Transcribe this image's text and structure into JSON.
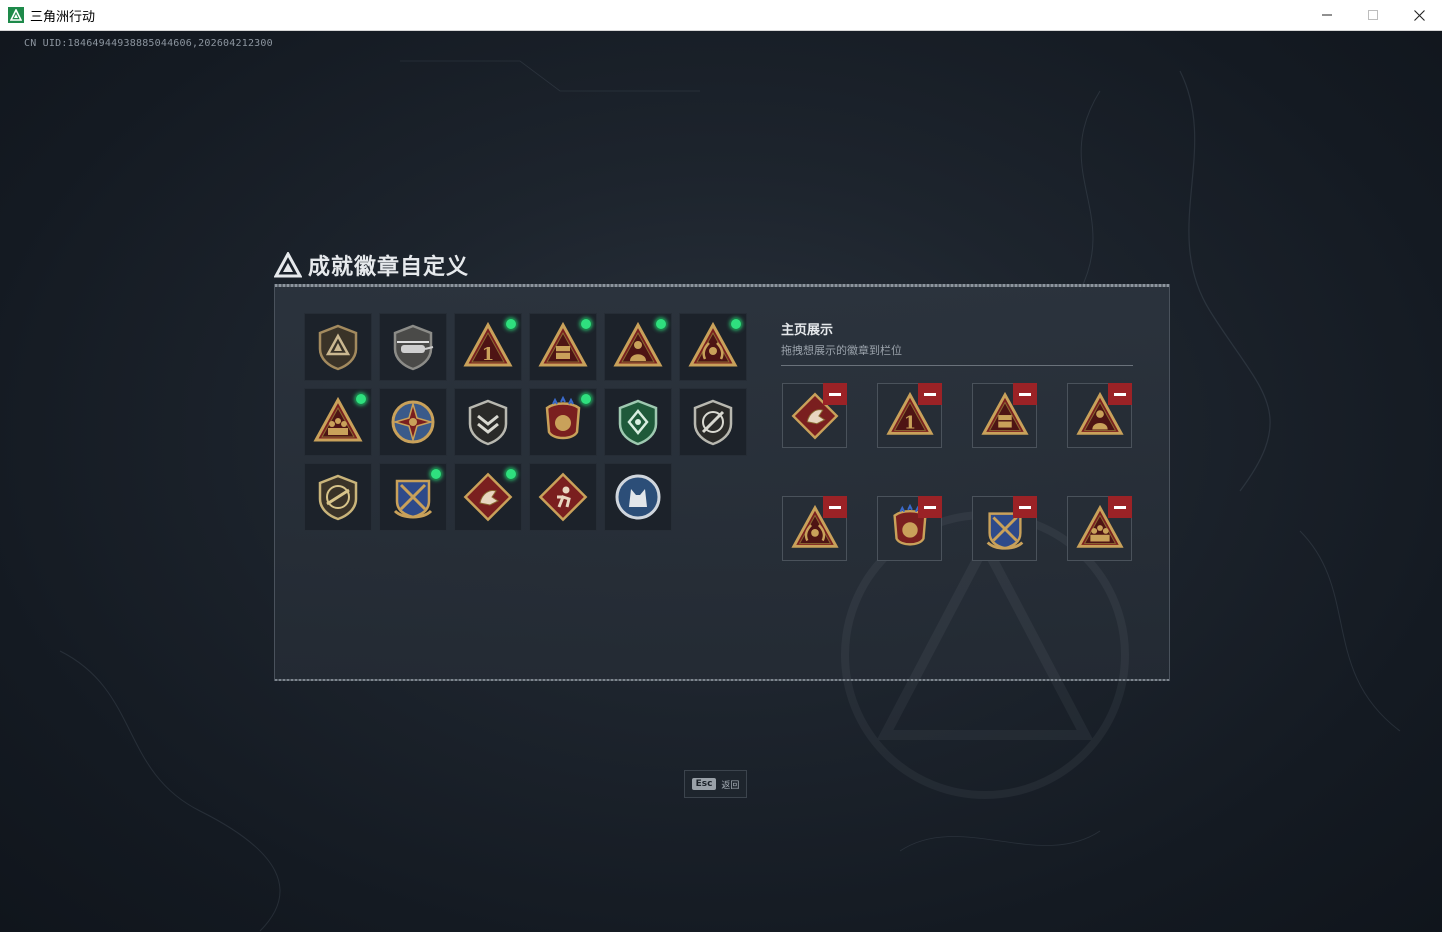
{
  "window": {
    "title": "三角洲行动",
    "controls": [
      "minimize",
      "maximize",
      "close"
    ]
  },
  "game": {
    "uid": "CN UID:18464944938885044606,202604212300",
    "heading": "成就徽章自定义"
  },
  "inventory": {
    "badges": [
      {
        "icon": "shield-triangle-badge-icon",
        "new": false
      },
      {
        "icon": "helicopter-badge-icon",
        "new": false
      },
      {
        "icon": "number-one-triangle-badge-icon",
        "new": true
      },
      {
        "icon": "supply-crate-triangle-badge-icon",
        "new": true
      },
      {
        "icon": "soldier-triangle-badge-icon",
        "new": true
      },
      {
        "icon": "laurel-triangle-badge-icon",
        "new": true
      },
      {
        "icon": "squad-triangle-badge-icon",
        "new": true
      },
      {
        "icon": "star-compass-badge-icon",
        "new": false
      },
      {
        "icon": "chevron-shield-badge-icon",
        "new": false
      },
      {
        "icon": "starred-crest-badge-icon",
        "new": true
      },
      {
        "icon": "green-diamond-shield-badge-icon",
        "new": false
      },
      {
        "icon": "blade-shield-badge-icon",
        "new": false
      },
      {
        "icon": "rifle-shield-badge-icon",
        "new": false
      },
      {
        "icon": "crossed-rifles-crest-badge-icon",
        "new": true
      },
      {
        "icon": "dragon-diamond-badge-icon",
        "new": true
      },
      {
        "icon": "runner-diamond-badge-icon",
        "new": false
      },
      {
        "icon": "wolf-circle-badge-icon",
        "new": false
      }
    ]
  },
  "display": {
    "title": "主页展示",
    "subtitle": "拖拽想展示的徽章到栏位",
    "slots": [
      {
        "icon": "dragon-diamond-badge-icon"
      },
      {
        "icon": "number-one-triangle-badge-icon"
      },
      {
        "icon": "supply-crate-triangle-badge-icon"
      },
      {
        "icon": "soldier-triangle-badge-icon"
      },
      {
        "icon": "laurel-triangle-badge-icon"
      },
      {
        "icon": "starred-crest-badge-icon"
      },
      {
        "icon": "crossed-rifles-crest-badge-icon"
      },
      {
        "icon": "squad-triangle-badge-icon"
      }
    ]
  },
  "footer": {
    "esc_key": "Esc",
    "esc_label": "返回"
  },
  "colors": {
    "new_indicator": "#2fe07e",
    "remove_button": "#9b2226",
    "badge_gold": "#c9a15a",
    "badge_red": "#7a1f1f"
  }
}
